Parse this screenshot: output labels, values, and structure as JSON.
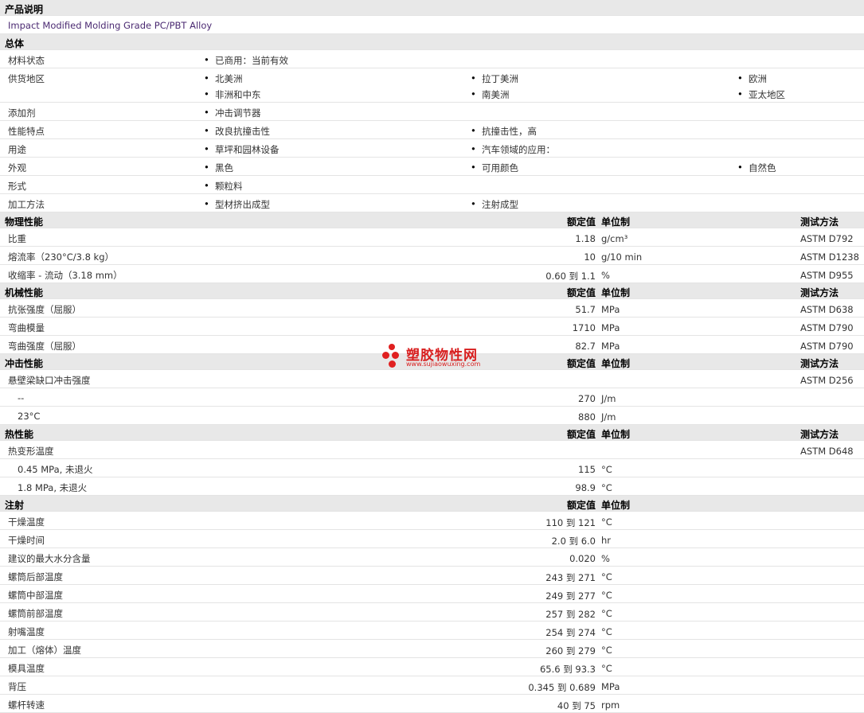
{
  "product": {
    "header": "产品说明",
    "description": "Impact Modified Molding Grade PC/PBT Alloy"
  },
  "general": {
    "header": "总体",
    "rows": [
      {
        "label": "材料状态",
        "items": [
          [
            "已商用：当前有效"
          ]
        ]
      },
      {
        "label": "供货地区",
        "items": [
          [
            "北美洲",
            "拉丁美洲",
            "欧洲"
          ],
          [
            "非洲和中东",
            "南美洲",
            "亚太地区"
          ]
        ]
      },
      {
        "label": "添加剂",
        "items": [
          [
            "冲击调节器"
          ]
        ]
      },
      {
        "label": "性能特点",
        "items": [
          [
            "改良抗撞击性",
            "抗撞击性，高"
          ]
        ]
      },
      {
        "label": "用途",
        "items": [
          [
            "草坪和园林设备",
            "汽车领域的应用："
          ]
        ]
      },
      {
        "label": "外观",
        "items": [
          [
            "黑色",
            "可用颜色",
            "自然色"
          ]
        ]
      },
      {
        "label": "形式",
        "items": [
          [
            "颗粒料"
          ]
        ]
      },
      {
        "label": "加工方法",
        "items": [
          [
            "型材挤出成型",
            "注射成型"
          ]
        ]
      }
    ]
  },
  "columns": {
    "nominal": "额定值",
    "unit": "单位制",
    "test": "测试方法"
  },
  "physical": {
    "header": "物理性能",
    "rows": [
      {
        "label": "比重",
        "value": "1.18",
        "unit": "g/cm³",
        "test": "ASTM D792"
      },
      {
        "label": "熔流率（230°C/3.8 kg）",
        "value": "10",
        "unit": "g/10 min",
        "test": "ASTM D1238"
      },
      {
        "label": "收缩率 - 流动（3.18 mm）",
        "value": "0.60 到  1.1",
        "unit": "%",
        "test": "ASTM D955"
      }
    ]
  },
  "mechanical": {
    "header": "机械性能",
    "rows": [
      {
        "label": "抗张强度（屈服）",
        "value": "51.7",
        "unit": "MPa",
        "test": "ASTM D638"
      },
      {
        "label": "弯曲模量",
        "value": "1710",
        "unit": "MPa",
        "test": "ASTM D790"
      },
      {
        "label": "弯曲强度（屈服）",
        "value": "82.7",
        "unit": "MPa",
        "test": "ASTM D790"
      }
    ]
  },
  "impact": {
    "header": "冲击性能",
    "rows": [
      {
        "label": "悬壁梁缺口冲击强度",
        "value": "",
        "unit": "",
        "test": "ASTM D256"
      },
      {
        "label": "--",
        "value": "270",
        "unit": "J/m",
        "test": "",
        "sub": true
      },
      {
        "label": "23°C",
        "value": "880",
        "unit": "J/m",
        "test": "",
        "sub": true
      }
    ]
  },
  "thermal": {
    "header": "热性能",
    "rows": [
      {
        "label": "热变形温度",
        "value": "",
        "unit": "",
        "test": "ASTM D648"
      },
      {
        "label": "0.45 MPa, 未退火",
        "value": "115",
        "unit": "°C",
        "test": "",
        "sub": true
      },
      {
        "label": "1.8 MPa, 未退火",
        "value": "98.9",
        "unit": "°C",
        "test": "",
        "sub": true
      }
    ]
  },
  "injection": {
    "header": "注射",
    "rows": [
      {
        "label": "干燥温度",
        "value": "110 到  121",
        "unit": "°C"
      },
      {
        "label": "干燥时间",
        "value": "2.0 到  6.0",
        "unit": "hr"
      },
      {
        "label": "建议的最大水分含量",
        "value": "0.020",
        "unit": "%"
      },
      {
        "label": "螺筒后部温度",
        "value": "243 到  271",
        "unit": "°C"
      },
      {
        "label": "螺筒中部温度",
        "value": "249 到  277",
        "unit": "°C"
      },
      {
        "label": "螺筒前部温度",
        "value": "257 到  282",
        "unit": "°C"
      },
      {
        "label": "射嘴温度",
        "value": "254 到  274",
        "unit": "°C"
      },
      {
        "label": "加工（熔体）温度",
        "value": "260 到  279",
        "unit": "°C"
      },
      {
        "label": "模具温度",
        "value": "65.6 到  93.3",
        "unit": "°C"
      },
      {
        "label": "背压",
        "value": "0.345 到  0.689",
        "unit": "MPa"
      },
      {
        "label": "螺杆转速",
        "value": "40 到  75",
        "unit": "rpm"
      }
    ]
  },
  "watermark": {
    "name": "塑胶物性网",
    "url": "www.sujiaowuxing.com",
    "color": "#d81e1e"
  }
}
